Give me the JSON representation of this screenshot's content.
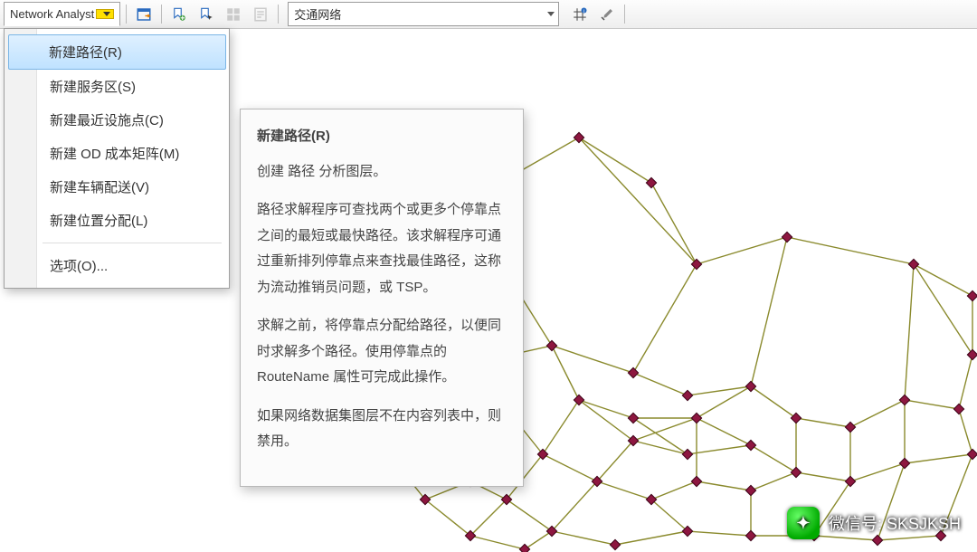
{
  "toolbar": {
    "dropdown_label": "Network Analyst",
    "network_combo": "交通网络"
  },
  "menu": {
    "items": [
      "新建路径(R)",
      "新建服务区(S)",
      "新建最近设施点(C)",
      "新建 OD 成本矩阵(M)",
      "新建车辆配送(V)",
      "新建位置分配(L)"
    ],
    "options": "选项(O)..."
  },
  "tooltip": {
    "title": "新建路径(R)",
    "p1": "创建 路径 分析图层。",
    "p2": "路径求解程序可查找两个或更多个停靠点之间的最短或最快路径。该求解程序可通过重新排列停靠点来查找最佳路径，这称为流动推销员问题，或 TSP。",
    "p3": "求解之前，将停靠点分配给路径，以便同时求解多个路径。使用停靠点的 RouteName 属性可完成此操作。",
    "p4": "如果网络数据集图层不在内容列表中，则禁用。"
  },
  "watermark": {
    "label_prefix": "微信号",
    "label_value": "SKSJKSH"
  },
  "colors": {
    "edge": "#8a8a2d",
    "node_fill": "#8d1740",
    "node_stroke": "#3b0016",
    "highlight": "#bfe2ff"
  }
}
